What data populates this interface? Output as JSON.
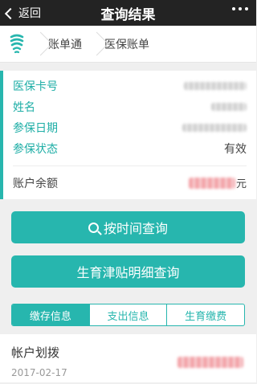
{
  "nav": {
    "back_label": "返回",
    "title": "查询结果"
  },
  "breadcrumb": {
    "items": [
      "账单通",
      "医保账单"
    ]
  },
  "info": {
    "rows": [
      {
        "label": "医保卡号",
        "value": ""
      },
      {
        "label": "姓名",
        "value": ""
      },
      {
        "label": "参保日期",
        "value": ""
      },
      {
        "label": "参保状态",
        "value": "有效"
      }
    ],
    "balance_label": "账户余额",
    "balance_unit": "元"
  },
  "buttons": {
    "time_query": "按时间查询",
    "allowance_query": "生育津贴明细查询"
  },
  "tabs": [
    {
      "label": "缴存信息",
      "active": true
    },
    {
      "label": "支出信息",
      "active": false
    },
    {
      "label": "生育缴费",
      "active": false
    }
  ],
  "records": [
    {
      "title": "帐户划拨",
      "date": "2017-02-17"
    }
  ],
  "colors": {
    "accent": "#27b6ae",
    "nav_bg": "#232323"
  }
}
